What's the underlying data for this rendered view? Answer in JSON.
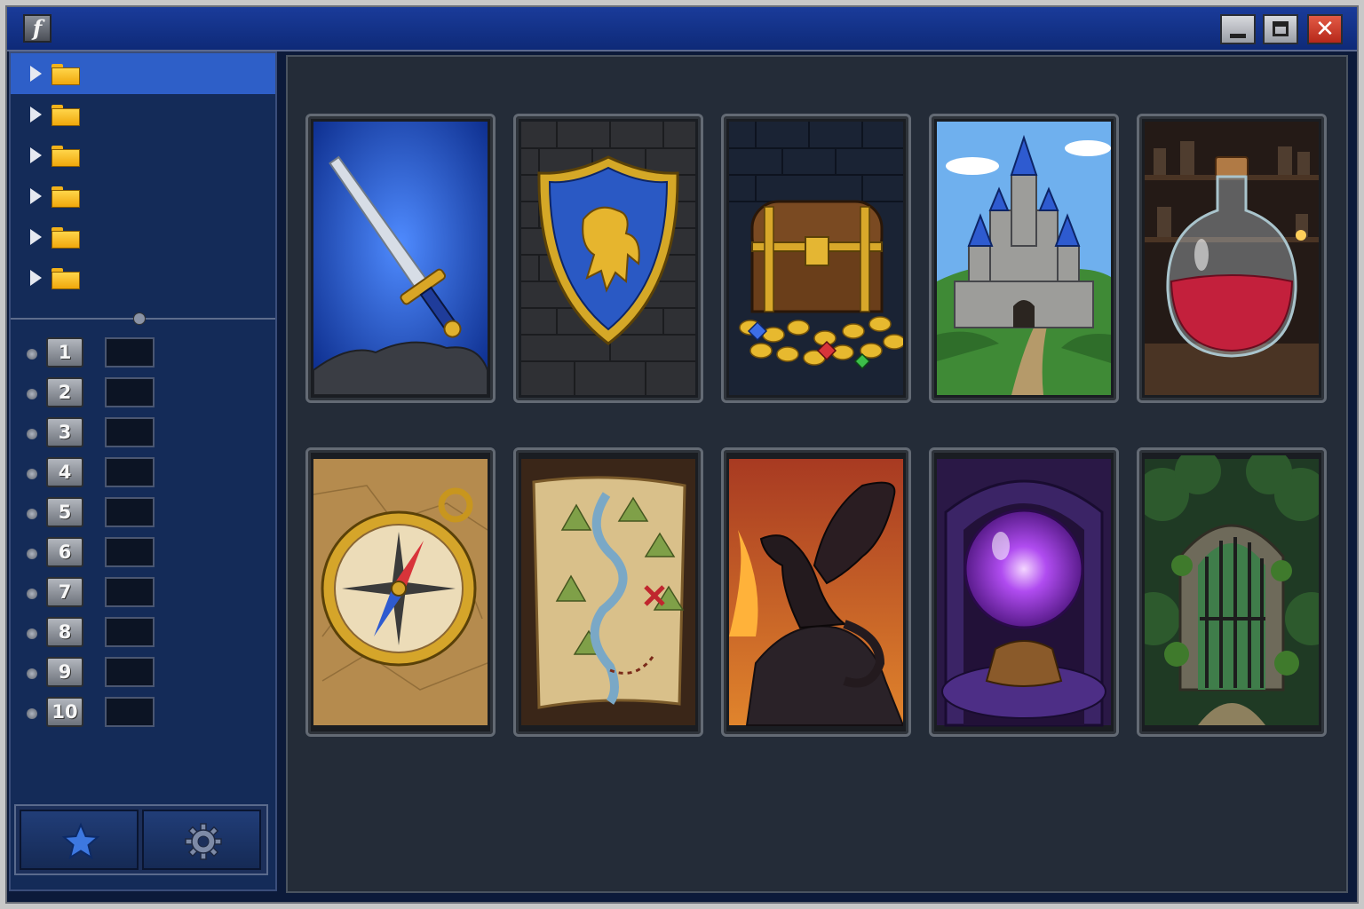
{
  "window": {
    "app_icon_glyph": "f",
    "buttons": {
      "minimize": "minimize-icon",
      "maximize": "maximize-icon",
      "close": "close-icon",
      "close_glyph": "✕"
    }
  },
  "sidebar": {
    "folders": [
      {
        "icon": "folder-icon",
        "selected": true
      },
      {
        "icon": "folder-icon",
        "selected": false
      },
      {
        "icon": "folder-icon",
        "selected": false
      },
      {
        "icon": "folder-icon",
        "selected": false
      },
      {
        "icon": "folder-icon",
        "selected": false
      },
      {
        "icon": "folder-icon",
        "selected": false
      }
    ],
    "slots": [
      {
        "number": "1",
        "value": ""
      },
      {
        "number": "2",
        "value": ""
      },
      {
        "number": "3",
        "value": ""
      },
      {
        "number": "4",
        "value": ""
      },
      {
        "number": "5",
        "value": ""
      },
      {
        "number": "6",
        "value": ""
      },
      {
        "number": "7",
        "value": ""
      },
      {
        "number": "8",
        "value": ""
      },
      {
        "number": "9",
        "value": ""
      },
      {
        "number": "10",
        "value": ""
      }
    ],
    "bottom_buttons": [
      {
        "icon": "star-icon"
      },
      {
        "icon": "gear-icon"
      }
    ]
  },
  "gallery": {
    "cards": [
      {
        "subject": "sword-icon"
      },
      {
        "subject": "lion-shield-icon"
      },
      {
        "subject": "treasure-chest-icon"
      },
      {
        "subject": "castle-icon"
      },
      {
        "subject": "potion-icon"
      },
      {
        "subject": "compass-icon"
      },
      {
        "subject": "treasure-map-icon"
      },
      {
        "subject": "dragon-icon"
      },
      {
        "subject": "crystal-ball-icon"
      },
      {
        "subject": "forest-gate-icon"
      }
    ]
  },
  "colors": {
    "titlebar": "#1a3b9a",
    "selection": "#2e5fc8",
    "sidebar": "#142b58",
    "gallery": "#242c38",
    "close": "#c8321f"
  }
}
